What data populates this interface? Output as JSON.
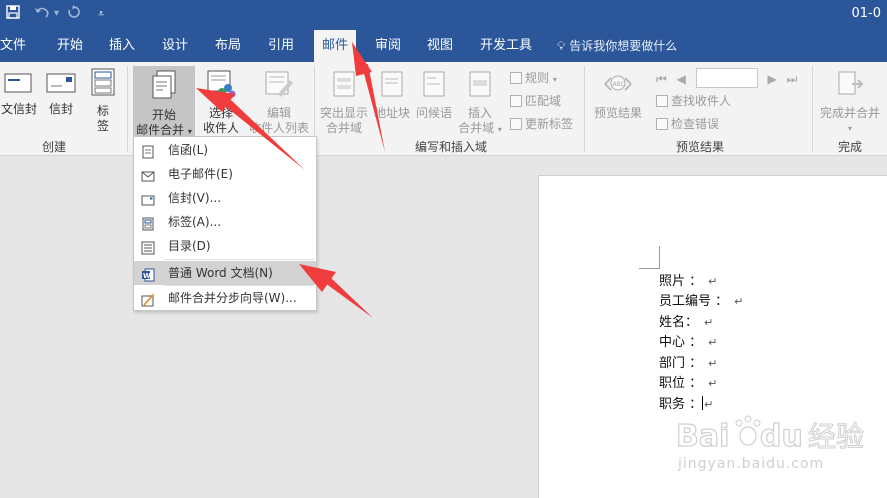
{
  "titlebar": {
    "title": "01-0",
    "save_icon": "save-icon",
    "undo_icon": "undo-icon",
    "redo_icon": "redo-icon",
    "customize_icon": "customize-qat-icon"
  },
  "tabs": [
    "文件",
    "开始",
    "插入",
    "设计",
    "布局",
    "引用",
    "邮件",
    "审阅",
    "视图",
    "开发工具"
  ],
  "active_tab": "邮件",
  "tell_me": "告诉我你想要做什么",
  "ribbon": {
    "create": {
      "label": "创建",
      "btn_chinese_envelope": "文信封",
      "btn_envelope": "信封",
      "btn_label_top": "标",
      "btn_label_bottom": "签"
    },
    "start_merge": {
      "btn_start_top": "开始",
      "btn_start_bottom": "邮件合并",
      "btn_select_top": "选择",
      "btn_select_bottom": "收件人",
      "btn_edit_top": "编辑",
      "btn_edit_bottom": "收件人列表"
    },
    "write_insert": {
      "label": "编写和插入域",
      "btn_highlight_top": "突出显示",
      "btn_highlight_bottom": "合并域",
      "btn_address": "地址块",
      "btn_greeting": "问候语",
      "btn_insert_top": "插入",
      "btn_insert_bottom": "合并域",
      "small_rules": "规则",
      "small_match": "匹配域",
      "small_update": "更新标签"
    },
    "preview": {
      "label": "预览结果",
      "btn_preview": "预览结果",
      "small_find": "查找收件人",
      "small_check": "检查错误"
    },
    "finish": {
      "label": "完成",
      "btn_finish": "完成并合并"
    }
  },
  "menu": {
    "items": [
      {
        "label": "信函(L)",
        "icon": "letter-icon"
      },
      {
        "label": "电子邮件(E)",
        "icon": "email-icon"
      },
      {
        "label": "信封(V)...",
        "icon": "envelope-icon"
      },
      {
        "label": "标签(A)...",
        "icon": "labels-icon"
      },
      {
        "label": "目录(D)",
        "icon": "directory-icon"
      },
      {
        "label": "普通 Word 文档(N)",
        "icon": "word-doc-icon"
      },
      {
        "label": "邮件合并分步向导(W)...",
        "icon": "wizard-icon"
      }
    ]
  },
  "document": {
    "lines": [
      "照片 ：",
      "员工编号 ：",
      "姓名：",
      "中心 ：",
      "部门 ：",
      "职位 ：",
      "职务 ："
    ],
    "paragraph_mark": "↵"
  },
  "watermark": {
    "text": "jingyan.baidu.com",
    "logo_text": "Bai",
    "logo_text2": "du",
    "logo_text3": "经验"
  },
  "colors": {
    "title_blue": "#2b579a",
    "ribbon_bg": "#f3f3f3",
    "arrow_red": "#f03c3c"
  }
}
